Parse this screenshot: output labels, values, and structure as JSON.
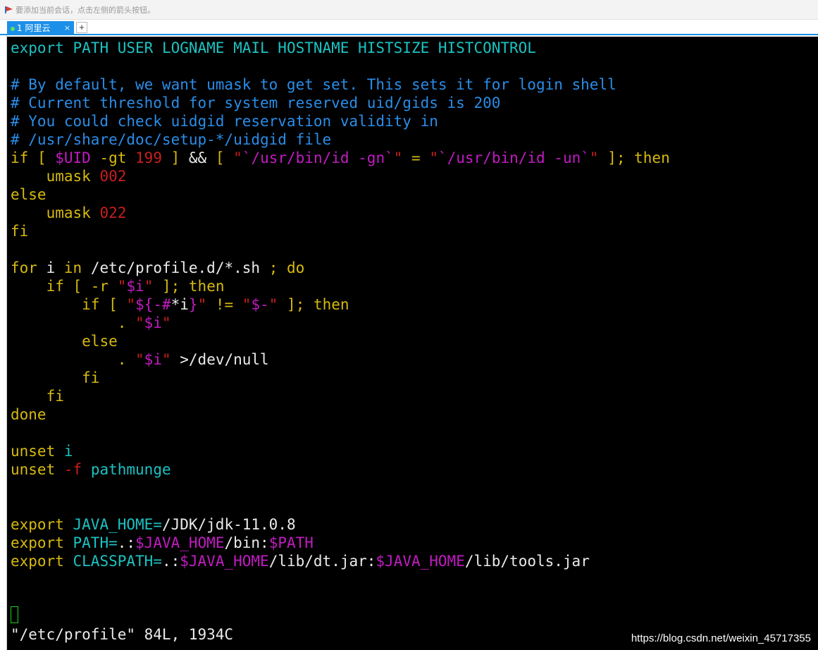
{
  "hintbar": {
    "text": "要添加当前会话，点击左侧的箭头按钮。"
  },
  "tabs": [
    {
      "label": "1 阿里云",
      "close": "×"
    }
  ],
  "tab_add": "+",
  "terminal": {
    "lines": [
      [
        [
          "cy",
          "export"
        ],
        [
          "wh",
          " "
        ],
        [
          "cy",
          "PATH USER LOGNAME MAIL HOSTNAME HISTSIZE HISTCONTROL"
        ]
      ],
      [],
      [
        [
          "cm",
          "# By default, we want umask to get set. This sets it for login shell"
        ]
      ],
      [
        [
          "cm",
          "# Current threshold for system reserved uid/gids is 200"
        ]
      ],
      [
        [
          "cm",
          "# You could check uidgid reservation validity in"
        ]
      ],
      [
        [
          "cm",
          "# /usr/share/doc/setup-*/uidgid file"
        ]
      ],
      [
        [
          "kw",
          "if"
        ],
        [
          "kw",
          " [ "
        ],
        [
          "mg",
          "$UID"
        ],
        [
          "kw",
          " -gt "
        ],
        [
          "rd",
          "199"
        ],
        [
          "kw",
          " ]"
        ],
        [
          "wh",
          " && "
        ],
        [
          "kw",
          "[ "
        ],
        [
          "rd",
          "\""
        ],
        [
          "mg",
          "`/usr/bin/id -gn`"
        ],
        [
          "rd",
          "\""
        ],
        [
          "kw",
          " = "
        ],
        [
          "rd",
          "\""
        ],
        [
          "mg",
          "`/usr/bin/id -un`"
        ],
        [
          "rd",
          "\""
        ],
        [
          "kw",
          " ]; then"
        ]
      ],
      [
        [
          "wh",
          "    "
        ],
        [
          "kw",
          "umask"
        ],
        [
          "wh",
          " "
        ],
        [
          "rd",
          "002"
        ]
      ],
      [
        [
          "kw",
          "else"
        ]
      ],
      [
        [
          "wh",
          "    "
        ],
        [
          "kw",
          "umask"
        ],
        [
          "wh",
          " "
        ],
        [
          "rd",
          "022"
        ]
      ],
      [
        [
          "kw",
          "fi"
        ]
      ],
      [],
      [
        [
          "kw",
          "for"
        ],
        [
          "wh",
          " i "
        ],
        [
          "kw",
          "in"
        ],
        [
          "wh",
          " /etc/profile.d/*.sh "
        ],
        [
          "kw",
          "; do"
        ]
      ],
      [
        [
          "wh",
          "    "
        ],
        [
          "kw",
          "if [ -r "
        ],
        [
          "rd",
          "\""
        ],
        [
          "mg",
          "$i"
        ],
        [
          "rd",
          "\""
        ],
        [
          "kw",
          " ]; then"
        ]
      ],
      [
        [
          "wh",
          "        "
        ],
        [
          "kw",
          "if [ "
        ],
        [
          "rd",
          "\""
        ],
        [
          "mg",
          "${-#"
        ],
        [
          "wh",
          "*i"
        ],
        [
          "mg",
          "}"
        ],
        [
          "rd",
          "\""
        ],
        [
          "kw",
          " != "
        ],
        [
          "rd",
          "\""
        ],
        [
          "mg",
          "$-"
        ],
        [
          "rd",
          "\""
        ],
        [
          "kw",
          " ]; then"
        ]
      ],
      [
        [
          "wh",
          "            "
        ],
        [
          "kw",
          ". "
        ],
        [
          "rd",
          "\""
        ],
        [
          "mg",
          "$i"
        ],
        [
          "rd",
          "\""
        ]
      ],
      [
        [
          "wh",
          "        "
        ],
        [
          "kw",
          "else"
        ]
      ],
      [
        [
          "wh",
          "            "
        ],
        [
          "kw",
          ". "
        ],
        [
          "rd",
          "\""
        ],
        [
          "mg",
          "$i"
        ],
        [
          "rd",
          "\""
        ],
        [
          "wh",
          " >/dev/null"
        ]
      ],
      [
        [
          "wh",
          "        "
        ],
        [
          "kw",
          "fi"
        ]
      ],
      [
        [
          "wh",
          "    "
        ],
        [
          "kw",
          "fi"
        ]
      ],
      [
        [
          "kw",
          "done"
        ]
      ],
      [],
      [
        [
          "kw",
          "unset"
        ],
        [
          "wh",
          " "
        ],
        [
          "cy",
          "i"
        ]
      ],
      [
        [
          "kw",
          "unset"
        ],
        [
          "wh",
          " "
        ],
        [
          "rd",
          "-f"
        ],
        [
          "wh",
          " "
        ],
        [
          "cy",
          "pathmunge"
        ]
      ],
      [],
      [],
      [
        [
          "kw",
          "export"
        ],
        [
          "wh",
          " "
        ],
        [
          "cy",
          "JAVA_HOME="
        ],
        [
          "wh",
          "/JDK/jdk-11.0.8"
        ]
      ],
      [
        [
          "kw",
          "export"
        ],
        [
          "wh",
          " "
        ],
        [
          "cy",
          "PATH="
        ],
        [
          "wh",
          ".:"
        ],
        [
          "mg",
          "$JAVA_HOME"
        ],
        [
          "wh",
          "/bin:"
        ],
        [
          "mg",
          "$PATH"
        ]
      ],
      [
        [
          "kw",
          "export"
        ],
        [
          "wh",
          " "
        ],
        [
          "cy",
          "CLASSPATH="
        ],
        [
          "wh",
          ".:"
        ],
        [
          "mg",
          "$JAVA_HOME"
        ],
        [
          "wh",
          "/lib/dt.jar:"
        ],
        [
          "mg",
          "$JAVA_HOME"
        ],
        [
          "wh",
          "/lib/tools.jar"
        ]
      ]
    ],
    "status": "\"/etc/profile\" 84L, 1934C"
  },
  "watermark": "https://blog.csdn.net/weixin_45717355",
  "colors": {
    "keyword": "#d6ba0f",
    "identifier": "#1cc2c2",
    "comment": "#2a8de8",
    "variable": "#c21bc2",
    "number_string": "#c81e1e",
    "tab_active": "#1c8fe8",
    "cursor": "#22cc22"
  }
}
